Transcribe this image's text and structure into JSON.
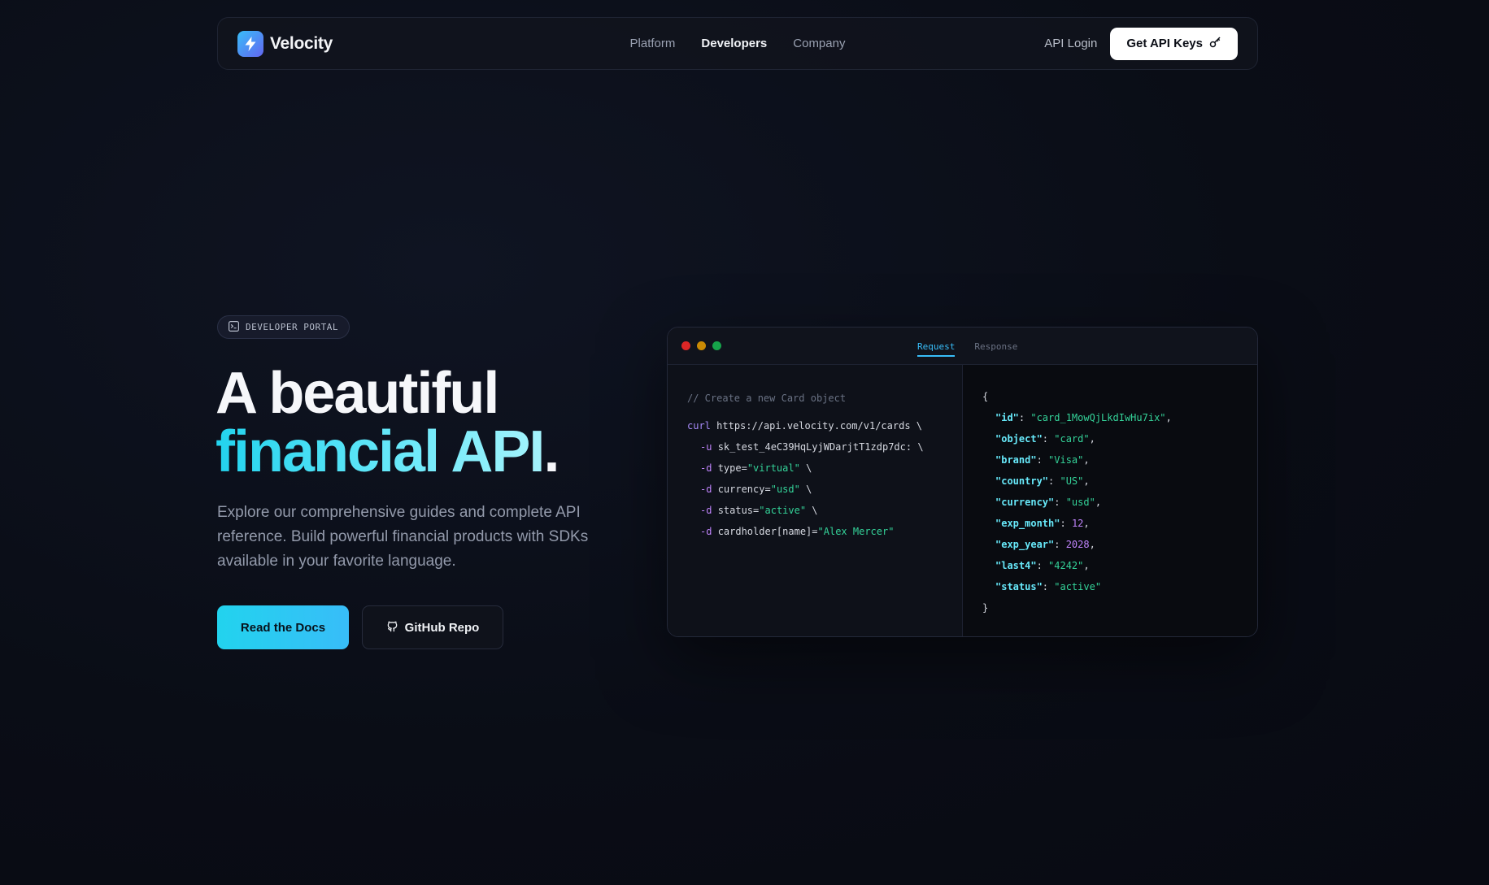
{
  "nav": {
    "brand": "Velocity",
    "links": [
      {
        "label": "Platform",
        "active": false
      },
      {
        "label": "Developers",
        "active": true
      },
      {
        "label": "Company",
        "active": false
      }
    ],
    "api_login": "API Login",
    "cta": "Get API Keys"
  },
  "hero": {
    "badge": "DEVELOPER PORTAL",
    "headline_line1": "A beautiful",
    "headline_accent": "financial API",
    "headline_period": ".",
    "subtext": "Explore our comprehensive guides and complete API reference. Build powerful financial products with SDKs available in your favorite language.",
    "primary_button": "Read the Docs",
    "secondary_button": "GitHub Repo"
  },
  "code_window": {
    "tabs": [
      {
        "label": "Request",
        "active": true
      },
      {
        "label": "Response",
        "active": false
      }
    ],
    "request": {
      "comment": "// Create a new Card object",
      "command": "curl",
      "url": "https://api.velocity.com/v1/cards \\",
      "user_flag": "-u",
      "user_value": "sk_test_4eC39HqLyjWDarjtT1zdp7dc: \\",
      "params": [
        {
          "flag": "-d",
          "key": "type=",
          "value": "\"virtual\"",
          "tail": " \\"
        },
        {
          "flag": "-d",
          "key": "currency=",
          "value": "\"usd\"",
          "tail": " \\"
        },
        {
          "flag": "-d",
          "key": "status=",
          "value": "\"active\"",
          "tail": " \\"
        },
        {
          "flag": "-d",
          "key": "cardholder[name]=",
          "value": "\"Alex Mercer\"",
          "tail": ""
        }
      ]
    },
    "response": {
      "open": "{",
      "close": "}",
      "fields": [
        {
          "key": "\"id\"",
          "value": "\"card_1MowQjLkdIwHu7ix\"",
          "type": "str",
          "comma": ","
        },
        {
          "key": "\"object\"",
          "value": "\"card\"",
          "type": "str",
          "comma": ","
        },
        {
          "key": "\"brand\"",
          "value": "\"Visa\"",
          "type": "str",
          "comma": ","
        },
        {
          "key": "\"country\"",
          "value": "\"US\"",
          "type": "str",
          "comma": ","
        },
        {
          "key": "\"currency\"",
          "value": "\"usd\"",
          "type": "str",
          "comma": ","
        },
        {
          "key": "\"exp_month\"",
          "value": "12",
          "type": "num",
          "comma": ","
        },
        {
          "key": "\"exp_year\"",
          "value": "2028",
          "type": "num",
          "comma": ","
        },
        {
          "key": "\"last4\"",
          "value": "\"4242\"",
          "type": "str",
          "comma": ","
        },
        {
          "key": "\"status\"",
          "value": "\"active\"",
          "type": "str",
          "comma": ""
        }
      ]
    },
    "traffic_lights": [
      "#dc2626",
      "#ca8a04",
      "#16a34a"
    ]
  },
  "colors": {
    "accent": "#22d3ee",
    "brand_gradient_start": "#38bdf8",
    "brand_gradient_end": "#6366f1"
  }
}
